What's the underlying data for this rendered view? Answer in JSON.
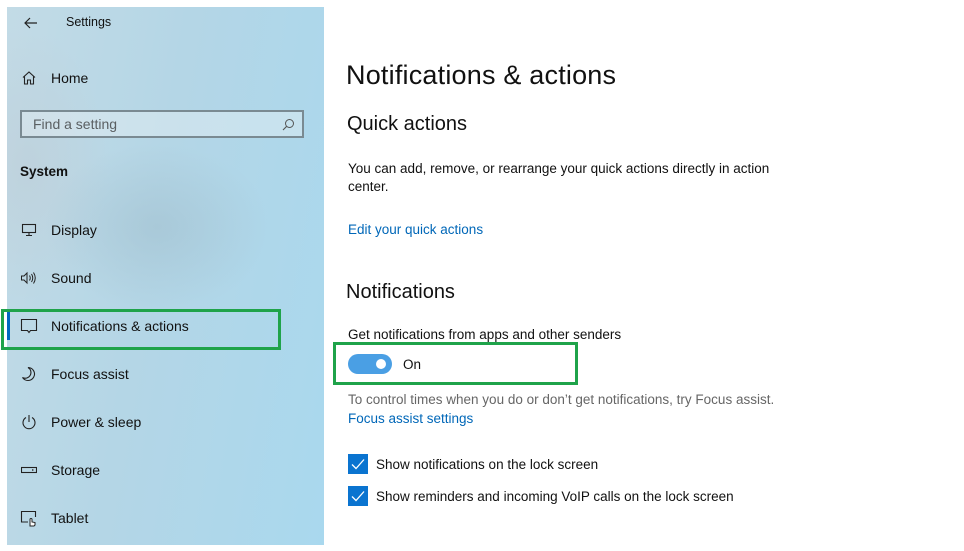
{
  "window": {
    "title": "Settings"
  },
  "sidebar": {
    "home_label": "Home",
    "search": {
      "placeholder": "Find a setting",
      "value": ""
    },
    "section_label": "System",
    "items": [
      {
        "label": "Display",
        "icon": "monitor-icon"
      },
      {
        "label": "Sound",
        "icon": "speaker-icon"
      },
      {
        "label": "Notifications & actions",
        "icon": "message-icon",
        "selected": true
      },
      {
        "label": "Focus assist",
        "icon": "moon-icon"
      },
      {
        "label": "Power & sleep",
        "icon": "power-icon"
      },
      {
        "label": "Storage",
        "icon": "storage-icon"
      },
      {
        "label": "Tablet",
        "icon": "tablet-icon"
      }
    ]
  },
  "main": {
    "title": "Notifications & actions",
    "quick_actions": {
      "heading": "Quick actions",
      "description": "You can add, remove, or rearrange your quick actions directly in action center.",
      "link": "Edit your quick actions"
    },
    "notifications": {
      "heading": "Notifications",
      "toggle_label": "Get notifications from apps and other senders",
      "toggle_state": "On",
      "toggle_on": true,
      "hint": "To control times when you do or don’t get notifications, try Focus assist.",
      "focus_link": "Focus assist settings",
      "checkboxes": [
        {
          "label": "Show notifications on the lock screen",
          "checked": true
        },
        {
          "label": "Show reminders and incoming VoIP calls on the lock screen",
          "checked": true
        }
      ]
    }
  },
  "colors": {
    "accent": "#0067b8",
    "toggle_on": "#4a9fe4",
    "checkbox": "#0a74d0",
    "highlight": "#1fa34a"
  }
}
